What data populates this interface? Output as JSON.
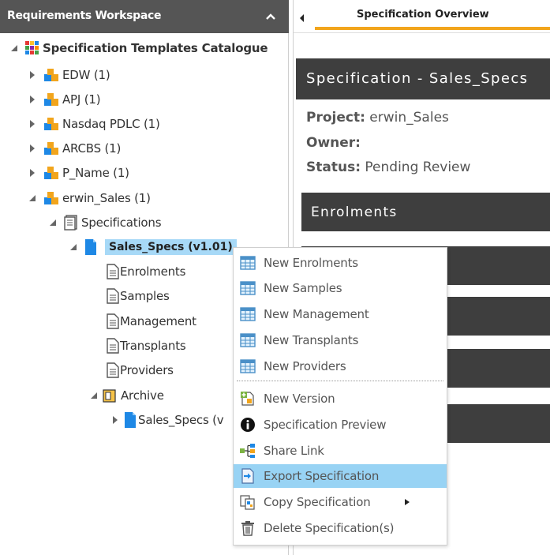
{
  "left_panel": {
    "title": "Requirements Workspace",
    "tree": {
      "root_label": "Specification Templates Catalogue",
      "projects": [
        {
          "label": "EDW (1)"
        },
        {
          "label": "APJ (1)"
        },
        {
          "label": "Nasdaq PDLC (1)"
        },
        {
          "label": "ARCBS (1)"
        },
        {
          "label": "P_Name (1)"
        },
        {
          "label": "erwin_Sales (1)"
        }
      ],
      "specifications_label": "Specifications",
      "selected_spec": "Sales_Specs (v1.01)",
      "sections": [
        {
          "label": "Enrolments"
        },
        {
          "label": "Samples"
        },
        {
          "label": "Management"
        },
        {
          "label": "Transplants"
        },
        {
          "label": "Providers"
        }
      ],
      "archive_label": "Archive",
      "archived_spec": "Sales_Specs (v"
    }
  },
  "right_panel": {
    "tab_label": "Specification Overview",
    "spec_title": "Specification - Sales_Specs",
    "project_key": "Project:",
    "project_value": " erwin_Sales",
    "owner_key": "Owner:",
    "owner_value": "",
    "status_key": "Status:",
    "status_value": " Pending Review",
    "section_header": "Enrolments"
  },
  "context_menu": {
    "items": [
      {
        "label": "New Enrolments",
        "icon": "table-icon"
      },
      {
        "label": "New Samples",
        "icon": "table-icon"
      },
      {
        "label": "New Management",
        "icon": "table-icon"
      },
      {
        "label": "New Transplants",
        "icon": "table-icon"
      },
      {
        "label": "New Providers",
        "icon": "table-icon"
      },
      {
        "label": "New Version",
        "icon": "new-version-icon"
      },
      {
        "label": "Specification Preview",
        "icon": "info-icon"
      },
      {
        "label": "Share Link",
        "icon": "share-link-icon"
      },
      {
        "label": "Export Specification",
        "icon": "export-icon"
      },
      {
        "label": "Copy Specification",
        "icon": "copy-icon"
      },
      {
        "label": "Delete Specification(s)",
        "icon": "trash-icon"
      }
    ],
    "highlighted": "Export Specification"
  },
  "colors": {
    "header_bg": "#555555",
    "dark_section": "#3e3e3e",
    "tab_underline": "#f2a51c",
    "selection": "#a7d9f7",
    "menu_highlight": "#98d3f4"
  }
}
